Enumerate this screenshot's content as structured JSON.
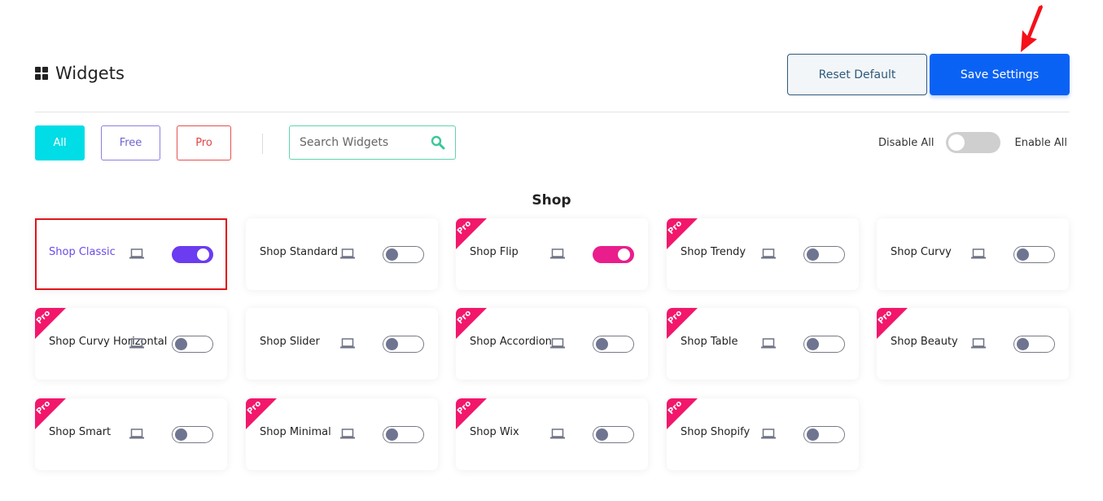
{
  "header": {
    "title": "Widgets",
    "icon": "grid-icon",
    "reset_label": "Reset Default",
    "save_label": "Save Settings"
  },
  "filters": {
    "all": "All",
    "free": "Free",
    "pro": "Pro",
    "active": "All"
  },
  "search": {
    "placeholder": "Search Widgets",
    "value": "",
    "icon": "search-icon"
  },
  "global_toggle": {
    "disable_label": "Disable All",
    "enable_label": "Enable All",
    "state": "off"
  },
  "section": {
    "title": "Shop"
  },
  "colors": {
    "accent_all": "#00dde6",
    "save_blue": "#0a62f5",
    "pro_ribbon": "#f2176b",
    "toggle_purple": "#6b3cf0",
    "toggle_pink": "#e91e8c",
    "highlight_red": "#e0151a"
  },
  "widgets": [
    {
      "name": "Shop Classic",
      "pro": false,
      "enabled": true,
      "selected": true,
      "toggle_color": "#6b3cf0"
    },
    {
      "name": "Shop Standard",
      "pro": false,
      "enabled": false
    },
    {
      "name": "Shop Flip",
      "pro": true,
      "enabled": true,
      "toggle_color": "#e91e8c"
    },
    {
      "name": "Shop Trendy",
      "pro": true,
      "enabled": false
    },
    {
      "name": "Shop Curvy",
      "pro": false,
      "enabled": false
    },
    {
      "name": "Shop Curvy Horizontal",
      "pro": true,
      "enabled": false
    },
    {
      "name": "Shop Slider",
      "pro": false,
      "enabled": false
    },
    {
      "name": "Shop Accordion",
      "pro": true,
      "enabled": false
    },
    {
      "name": "Shop Table",
      "pro": true,
      "enabled": false
    },
    {
      "name": "Shop Beauty",
      "pro": true,
      "enabled": false
    },
    {
      "name": "Shop Smart",
      "pro": true,
      "enabled": false
    },
    {
      "name": "Shop Minimal",
      "pro": true,
      "enabled": false
    },
    {
      "name": "Shop Wix",
      "pro": true,
      "enabled": false
    },
    {
      "name": "Shop Shopify",
      "pro": true,
      "enabled": false
    }
  ],
  "pro_badge_label": "Pro",
  "device_icon": "laptop-icon",
  "annotation": "red-arrow-pointing-to-save"
}
